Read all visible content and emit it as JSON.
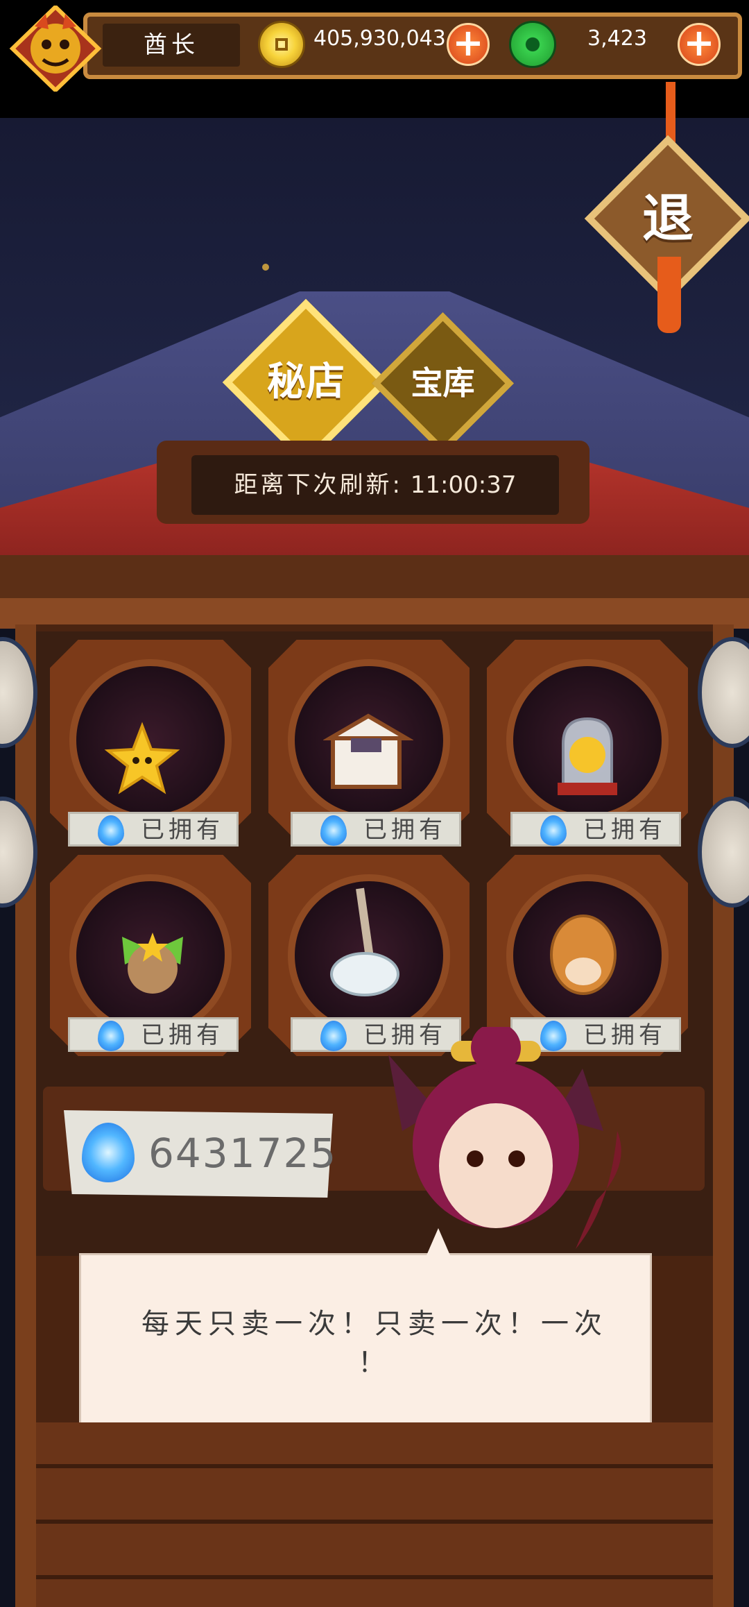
{
  "header": {
    "player_name": "酋长",
    "coins": "405,930,043",
    "jade": "3,423"
  },
  "exit_label": "退",
  "tabs": [
    {
      "label": "秘店",
      "selected": true
    },
    {
      "label": "宝库",
      "selected": false
    }
  ],
  "refresh": {
    "label": "距离下次刷新:",
    "time": "11:00:37"
  },
  "items": [
    {
      "icon": "star-plush-icon",
      "status": "已拥有"
    },
    {
      "icon": "treasure-chest-icon",
      "status": "已拥有"
    },
    {
      "icon": "yellow-cat-in-bell-jar-icon",
      "status": "已拥有"
    },
    {
      "icon": "sprout-creature-icon",
      "status": "已拥有"
    },
    {
      "icon": "porcelain-pot-icon",
      "status": "已拥有"
    },
    {
      "icon": "bread-creature-icon",
      "status": "已拥有"
    }
  ],
  "currency": {
    "icon": "blue-flame-icon",
    "amount": "6431725"
  },
  "dialog": {
    "line1": "每天只卖一次！只卖一次！一次",
    "line2": "！"
  },
  "colors": {
    "coin": "#f7d33a",
    "jade": "#39d04e",
    "plus_button": "#e4561e",
    "tab_selected": "#d8a51c",
    "flame": "#4fb3ff"
  }
}
